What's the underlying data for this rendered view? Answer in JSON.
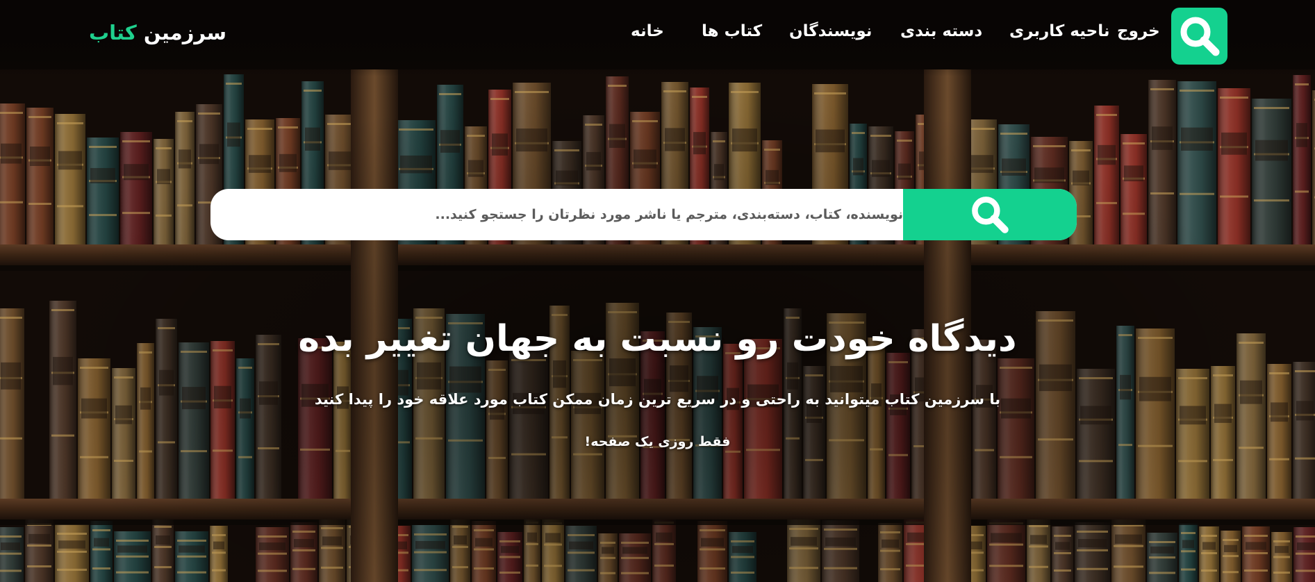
{
  "header": {
    "brand": {
      "main": "سرزمین ",
      "accent": "کتاب"
    },
    "nav": [
      {
        "id": "logout",
        "label": "خروج",
        "active": false
      },
      {
        "id": "user-area",
        "label": "ناحیه کاربری",
        "active": false
      },
      {
        "id": "categories",
        "label": "دسته بندی",
        "active": false
      },
      {
        "id": "authors",
        "label": "نویسندگان",
        "active": false
      },
      {
        "id": "books",
        "label": "کتاب ها",
        "active": false
      },
      {
        "id": "home",
        "label": "خانه",
        "active": true
      }
    ],
    "logo_icon": "search-icon"
  },
  "search": {
    "placeholder": "نویسنده، کتاب، دسته‌بندی، مترجم یا ناشر مورد نظرتان را جستجو کنید...",
    "value": "",
    "button_icon": "search-icon"
  },
  "hero": {
    "title": "دیدگاه خودت رو نسبت به جهان تغییر بده",
    "subtitle": "با سرزمین کتاب میتوانید به راحتی و در سریع ترین زمان ممکن کتاب مورد علاقه خود را پیدا کنید",
    "tagline": "فقط روزی یک صفحه!"
  },
  "colors": {
    "accent": "#14d18f",
    "accent_text": "#1fd18e",
    "text": "#ffffff",
    "search_bg": "#ffffff"
  },
  "background": "bookshelf-illustration"
}
